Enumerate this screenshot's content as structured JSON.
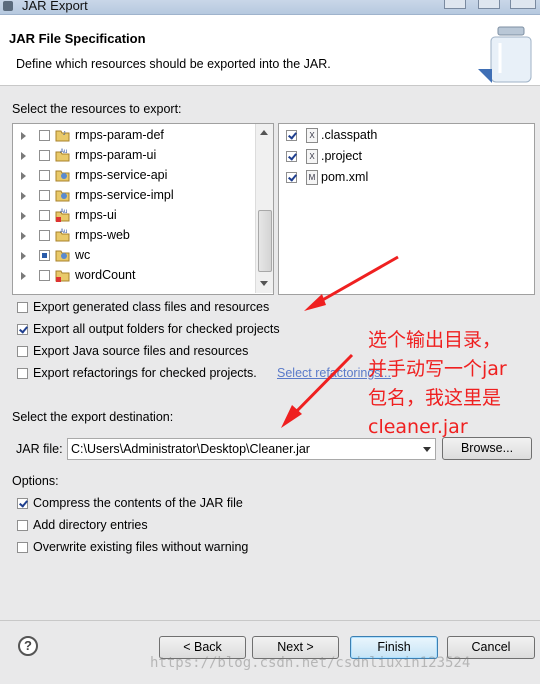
{
  "window": {
    "title": "JAR Export"
  },
  "header": {
    "title": "JAR File Specification",
    "description": "Define which resources should be exported into the JAR."
  },
  "resources": {
    "label": "Select the resources to export:",
    "tree": [
      {
        "label": "rmps-param-def",
        "state": "unchecked"
      },
      {
        "label": "rmps-param-ui",
        "state": "unchecked"
      },
      {
        "label": "rmps-service-api",
        "state": "unchecked"
      },
      {
        "label": "rmps-service-impl",
        "state": "unchecked"
      },
      {
        "label": "rmps-ui",
        "state": "unchecked"
      },
      {
        "label": "rmps-web",
        "state": "unchecked"
      },
      {
        "label": "wc",
        "state": "partial"
      },
      {
        "label": "wordCount",
        "state": "unchecked"
      }
    ],
    "files": [
      {
        "label": ".classpath",
        "icon": "X",
        "checked": true
      },
      {
        "label": ".project",
        "icon": "X",
        "checked": true
      },
      {
        "label": "pom.xml",
        "icon": "M",
        "checked": true
      }
    ]
  },
  "options_top": [
    {
      "label": "Export generated class files and resources",
      "checked": false
    },
    {
      "label": "Export all output folders for checked projects",
      "checked": true
    },
    {
      "label": "Export Java source files and resources",
      "checked": false
    },
    {
      "label": "Export refactorings for checked projects.",
      "checked": false,
      "link": "Select refactorings..."
    }
  ],
  "destination": {
    "label": "Select the export destination:",
    "jar_label": "JAR file:",
    "jar_value": "C:\\Users\\Administrator\\Desktop\\Cleaner.jar",
    "browse_label": "Browse..."
  },
  "options": {
    "label": "Options:",
    "items": [
      {
        "label": "Compress the contents of the JAR file",
        "checked": true
      },
      {
        "label": "Add directory entries",
        "checked": false
      },
      {
        "label": "Overwrite existing files without warning",
        "checked": false
      }
    ]
  },
  "buttons": {
    "help": "?",
    "back": "< Back",
    "next": "Next >",
    "finish": "Finish",
    "cancel": "Cancel"
  },
  "annotation": {
    "text_line1": "选个输出目录，",
    "text_line2": "并手动写一个jar",
    "text_line3": "包名，我这里是",
    "text_line4": "cleaner.jar",
    "color": "#ef2020"
  },
  "watermark": "https://blog.csdn.net/csdnliuxin123524"
}
